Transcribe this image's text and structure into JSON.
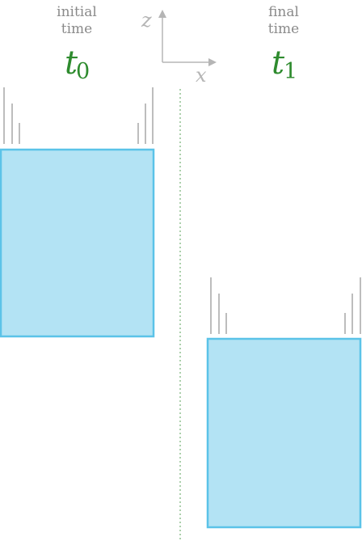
{
  "left_panel": {
    "caption_line1": "initial",
    "caption_line2": "time",
    "time_symbol": "t",
    "time_subscript": "0"
  },
  "right_panel": {
    "caption_line1": "final",
    "caption_line2": "time",
    "time_symbol": "t",
    "time_subscript": "1"
  },
  "axes": {
    "vertical_label": "z",
    "horizontal_label": "x"
  },
  "colors": {
    "block_fill": "#b3e3f4",
    "block_stroke": "#5bc3e8",
    "time_label": "#2e8b2e",
    "caption": "#8a8a8a",
    "axis": "#b5b5b5",
    "tick_marks": "#bdbdbd",
    "divider": "#5aa05a"
  }
}
